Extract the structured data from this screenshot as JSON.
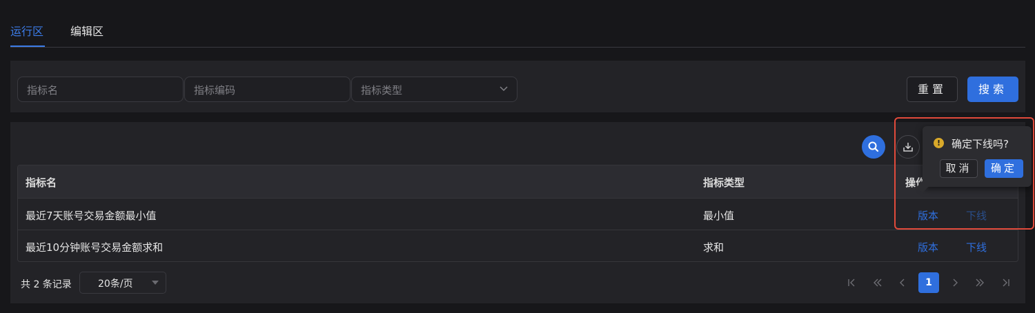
{
  "tabs": [
    {
      "label": "运行区",
      "active": true
    },
    {
      "label": "编辑区",
      "active": false
    }
  ],
  "filters": {
    "name_placeholder": "指标名",
    "code_placeholder": "指标编码",
    "type_placeholder": "指标类型",
    "reset_label": "重置",
    "search_label": "搜索"
  },
  "toolbar": {
    "search_icon": "search-icon",
    "download_icon": "download-icon"
  },
  "table": {
    "columns": [
      "指标名",
      "指标类型",
      "操作"
    ],
    "rows": [
      {
        "name": "最近7天账号交易金额最小值",
        "type": "最小值",
        "actions": [
          "版本",
          "下线"
        ]
      },
      {
        "name": "最近10分钟账号交易金额求和",
        "type": "求和",
        "actions": [
          "版本",
          "下线"
        ]
      }
    ]
  },
  "pagination": {
    "total_text": "共 2 条记录",
    "page_size": "20条/页",
    "current_page": "1"
  },
  "popconfirm": {
    "title": "确定下线吗?",
    "cancel_label": "取消",
    "ok_label": "确定"
  },
  "colors": {
    "primary": "#2f6fde",
    "background": "#17171a",
    "panel": "#232327",
    "warning": "#d9a92a",
    "annotation": "#e24a3b"
  }
}
